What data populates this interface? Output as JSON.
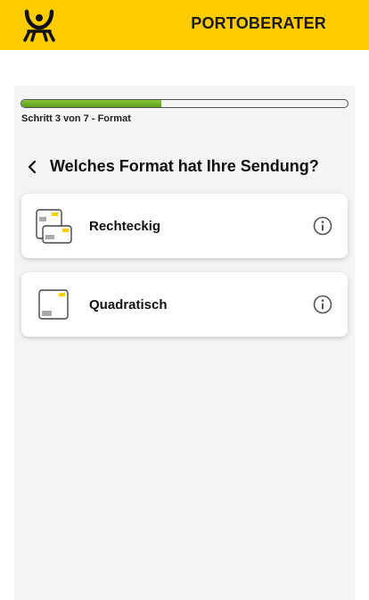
{
  "header": {
    "title": "PORTOBERATER",
    "background": "#ffcc00",
    "logo_icon": "post-horn-logo"
  },
  "progress": {
    "current_step": 3,
    "total_steps": 7,
    "fraction": 0.43,
    "label": "Schritt 3 von 7 - Format",
    "fill_color": "#6fb12a"
  },
  "question": {
    "back_icon": "chevron-left-icon",
    "title": "Welches Format hat Ihre Sendung?"
  },
  "options": [
    {
      "label": "Rechteckig",
      "icon": "rectangular-envelopes-icon",
      "info_icon": "info-icon"
    },
    {
      "label": "Quadratisch",
      "icon": "square-envelope-icon",
      "info_icon": "info-icon"
    }
  ]
}
